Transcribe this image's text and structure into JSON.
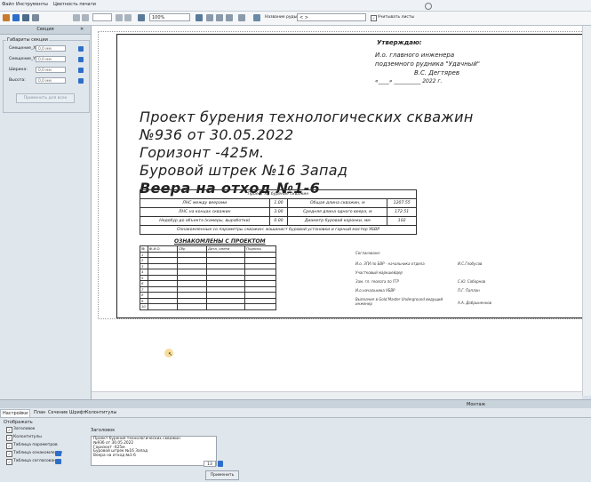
{
  "menu": [
    "Файл",
    "Инструменты",
    "Цветность печати"
  ],
  "toolbar": {
    "zoom": "100%",
    "layer_label": "Название руды",
    "layer_value": "< >",
    "checkbox_label": "Учитывать листы"
  },
  "left_panel": {
    "title": "Секция",
    "group_title": "Габариты секции",
    "fields": [
      {
        "label": "Смещение_X:",
        "value": "0,0 мм"
      },
      {
        "label": "Смещение_Y:",
        "value": "0,0 мм"
      },
      {
        "label": "Ширина:",
        "value": "0,0 мм"
      },
      {
        "label": "Высота:",
        "value": "0,0 мм"
      }
    ],
    "apply": "Применить для всех"
  },
  "sheet": {
    "approve": [
      "Утверждаю:",
      "И.о. главного инженера",
      "подземного рудника \"Удачный\"",
      "В.С. Дегтярев",
      "«____» __________ 2022 г."
    ],
    "title_lines": [
      "Проект бурения технологических скважин",
      "№936 от 30.05.2022",
      "Горизонт -425м.",
      "Буровой штрек №16 Запад",
      "Веера на отход №1-6"
    ],
    "params": {
      "header": "Проект на бурение скважин",
      "rows": [
        {
          "l1": "ЛНС между веерами",
          "v1": "1.00",
          "l2": "Общая длина скважин, м",
          "v2": "1207.55"
        },
        {
          "l1": "ЛНС на концах скважин",
          "v1": "3.00",
          "l2": "Средняя длина одного веера, м",
          "v2": "172.51"
        },
        {
          "l1": "Недобур до объекта (камеры, выработки)",
          "v1": "0.00",
          "l2": "Диаметр буровой коронки, мм",
          "v2": "102"
        }
      ],
      "footer": "Ознакомленные со параметры скважин: машинист буровой установки и горный мастер УБВР"
    },
    "acq": {
      "title": "ОЗНАКОМЛЕНЫ С ПРОЕКТОМ",
      "headers": [
        "№",
        "Ф.И.О.",
        "Сбр",
        "Дата, смена",
        "Подпись"
      ],
      "rows": [
        "1",
        "2",
        "3",
        "4",
        "5",
        "6",
        "7",
        "8",
        "9",
        "10"
      ]
    },
    "agreement": {
      "title": "Согласовано:",
      "rows": [
        {
          "role": "И.о. ЗГИ по БВР - начальника отдела",
          "name": "И.С.Глобусов"
        },
        {
          "role": "Участковый маркшейдер",
          "name": ""
        },
        {
          "role": "Зам. гл. геолога по ГГР",
          "name": "С.Ю. Соборнов"
        },
        {
          "role": "И.о.начальника УБВР",
          "name": "П.Г. Паплан"
        },
        {
          "role": "Выполнил в Gold Master Underground ведущий инженер",
          "name": "А.А. Добрыненков"
        }
      ]
    }
  },
  "montage_label": "Монтаж",
  "bottom_tabs": [
    "Настройки",
    "План",
    "Сечение",
    "Шрифт",
    "Колонтитулы"
  ],
  "bottom": {
    "display_title": "Отображать",
    "checks": [
      {
        "label": "Заголовок",
        "checked": true
      },
      {
        "label": "Колонтитулы",
        "checked": true
      },
      {
        "label": "Таблица параметров",
        "checked": true
      },
      {
        "label": "Таблица ознакомления",
        "checked": true
      },
      {
        "label": "Таблица согласования",
        "checked": true
      }
    ],
    "header_title": "Заголовок",
    "header_text": [
      "Проект бурения технологических скважин",
      "№936 от 30.05.2022",
      "Горизонт -425м.",
      "Буровой штрек №16 Запад",
      "Веера на отход №1-6"
    ],
    "font_size": "13",
    "apply": "Применить"
  }
}
